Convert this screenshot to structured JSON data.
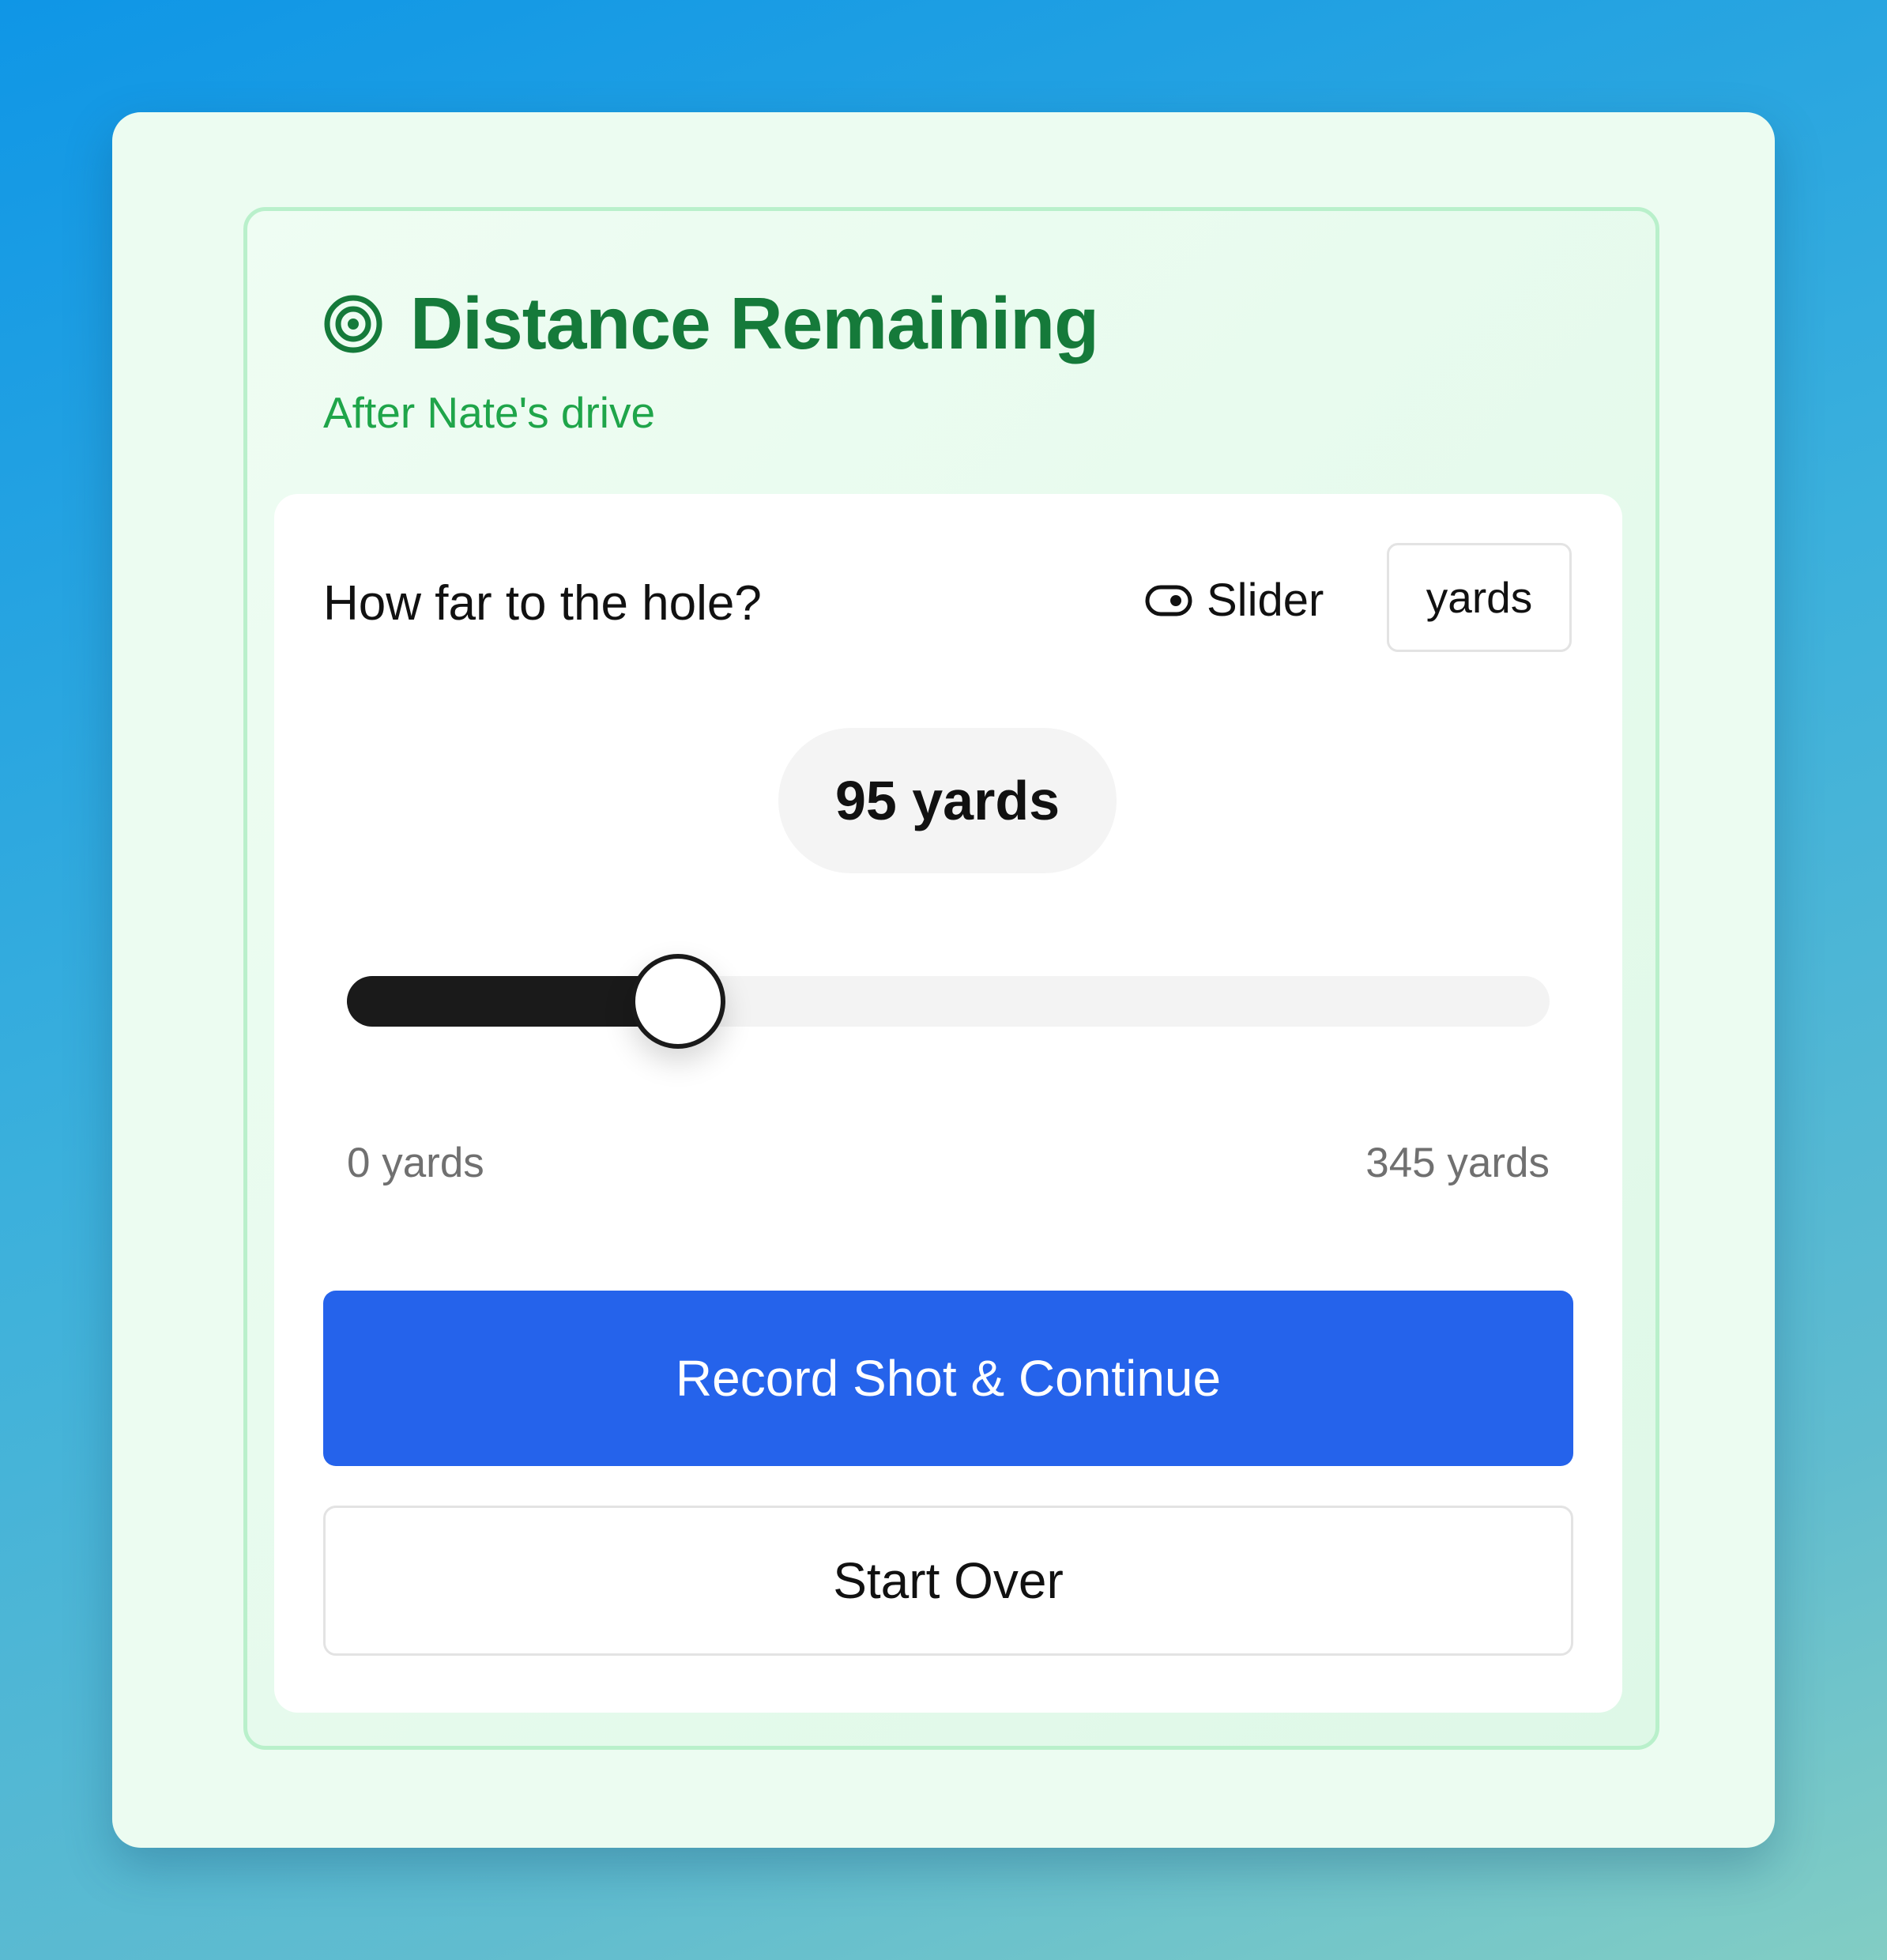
{
  "card": {
    "icon": "target-icon",
    "title": "Distance Remaining",
    "subtitle": "After Nate's drive",
    "accent_color": "#157a3a",
    "subtitle_color": "#1fa54a"
  },
  "input": {
    "question": "How far to the hole?",
    "mode_toggle": {
      "icon": "toggle-icon",
      "label": "Slider"
    },
    "unit_button_label": "yards",
    "current_value_label": "95 yards",
    "slider": {
      "value": 95,
      "min": 0,
      "max": 345,
      "unit": "yards"
    },
    "min_label": "0 yards",
    "max_label": "345 yards"
  },
  "actions": {
    "primary_label": "Record Shot & Continue",
    "primary_color": "#2563eb",
    "secondary_label": "Start Over"
  }
}
